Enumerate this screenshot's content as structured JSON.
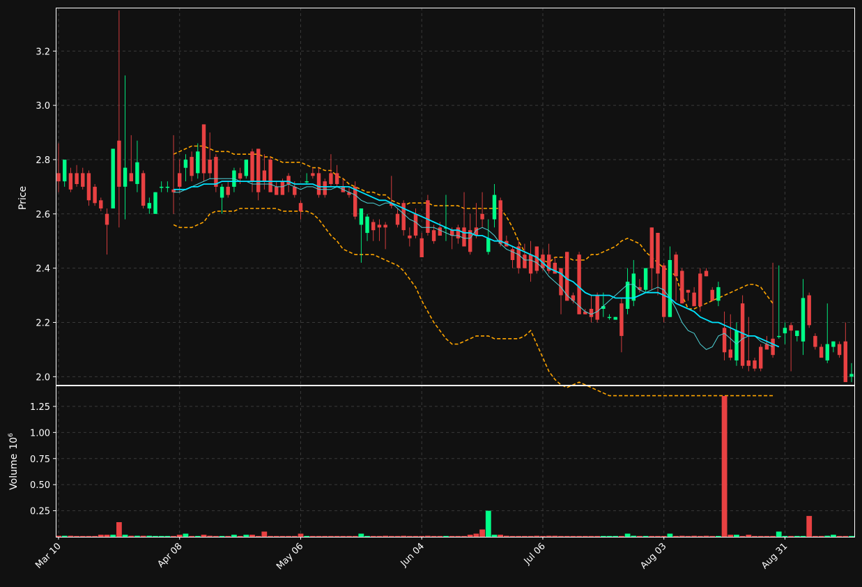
{
  "chart_data": {
    "type": "candlestick",
    "price_panel": {
      "ylabel": "Price",
      "ylim": [
        1.97,
        3.36
      ],
      "yticks": [
        "2.0",
        "2.2",
        "2.4",
        "2.6",
        "2.8",
        "3.0",
        "3.2"
      ],
      "grid": true
    },
    "volume_panel": {
      "ylabel": "Volume",
      "ylabel_exponent": "10",
      "ylabel_exponent_power": "6",
      "ylim": [
        0,
        1.45
      ],
      "yticks": [
        "0.25",
        "0.50",
        "0.75",
        "1.00",
        "1.25"
      ],
      "grid": true
    },
    "x_ticks": [
      {
        "label": "Mar 10",
        "index": 0
      },
      {
        "label": "Apr 08",
        "index": 20
      },
      {
        "label": "May 06",
        "index": 40
      },
      {
        "label": "Jun 04",
        "index": 60
      },
      {
        "label": "Jul 06",
        "index": 80
      },
      {
        "label": "Aug 03",
        "index": 100
      },
      {
        "label": "Aug 31",
        "index": 120
      }
    ],
    "colors": {
      "up": "#00ff88",
      "down": "#e84142",
      "ma_long": "#00e5ff",
      "ma_short": "#4fd4d9",
      "bands": "#ffa500"
    },
    "candles": [
      [
        2.75,
        2.86,
        2.68,
        2.72,
        0.01
      ],
      [
        2.72,
        2.8,
        2.7,
        2.8,
        0.01
      ],
      [
        2.75,
        2.77,
        2.68,
        2.69,
        0.01
      ],
      [
        2.75,
        2.78,
        2.7,
        2.71,
        0.0
      ],
      [
        2.75,
        2.77,
        2.69,
        2.7,
        0.0
      ],
      [
        2.75,
        2.76,
        2.63,
        2.65,
        0.0
      ],
      [
        2.7,
        2.71,
        2.63,
        2.64,
        0.0
      ],
      [
        2.65,
        2.66,
        2.61,
        2.62,
        0.02
      ],
      [
        2.6,
        2.62,
        2.45,
        2.56,
        0.02
      ],
      [
        2.62,
        2.84,
        2.62,
        2.84,
        0.02
      ],
      [
        2.87,
        3.35,
        2.55,
        2.7,
        0.14
      ],
      [
        2.7,
        3.11,
        2.58,
        2.77,
        0.02
      ],
      [
        2.75,
        2.89,
        2.72,
        2.72,
        0.01
      ],
      [
        2.71,
        2.87,
        2.68,
        2.79,
        0.01
      ],
      [
        2.75,
        2.76,
        2.62,
        2.63,
        0.01
      ],
      [
        2.62,
        2.66,
        2.6,
        2.64,
        0.01
      ],
      [
        2.6,
        2.68,
        2.6,
        2.68,
        0.0
      ],
      [
        2.7,
        2.72,
        2.68,
        2.7,
        0.0
      ],
      [
        2.7,
        2.72,
        2.68,
        2.7,
        0.0
      ],
      [
        2.69,
        2.89,
        2.6,
        2.68,
        0.0
      ],
      [
        2.75,
        2.8,
        2.68,
        2.7,
        0.02
      ],
      [
        2.77,
        2.82,
        2.72,
        2.8,
        0.03
      ],
      [
        2.81,
        2.83,
        2.72,
        2.74,
        0.0
      ],
      [
        2.75,
        2.86,
        2.73,
        2.83,
        0.0
      ],
      [
        2.93,
        2.93,
        2.72,
        2.75,
        0.02
      ],
      [
        2.8,
        2.9,
        2.73,
        2.75,
        0.01
      ],
      [
        2.81,
        2.82,
        2.68,
        2.7,
        0.0
      ],
      [
        2.66,
        2.71,
        2.6,
        2.7,
        0.0
      ],
      [
        2.7,
        2.72,
        2.66,
        2.67,
        0.0
      ],
      [
        2.7,
        2.77,
        2.68,
        2.76,
        0.02
      ],
      [
        2.75,
        2.77,
        2.71,
        2.73,
        0.0
      ],
      [
        2.74,
        2.8,
        2.73,
        2.8,
        0.02
      ],
      [
        2.83,
        2.84,
        2.68,
        2.72,
        0.02
      ],
      [
        2.84,
        2.84,
        2.65,
        2.68,
        0.0
      ],
      [
        2.76,
        2.82,
        2.69,
        2.72,
        0.05
      ],
      [
        2.8,
        2.81,
        2.68,
        2.68,
        0.0
      ],
      [
        2.7,
        2.72,
        2.67,
        2.67,
        0.0
      ],
      [
        2.72,
        2.73,
        2.67,
        2.67,
        0.0
      ],
      [
        2.74,
        2.75,
        2.68,
        2.71,
        0.0
      ],
      [
        2.7,
        2.72,
        2.66,
        2.67,
        0.0
      ],
      [
        2.64,
        2.65,
        2.58,
        2.61,
        0.03
      ],
      [
        2.72,
        2.75,
        2.71,
        2.72,
        0.0
      ],
      [
        2.75,
        2.77,
        2.73,
        2.74,
        0.0
      ],
      [
        2.75,
        2.77,
        2.66,
        2.67,
        0.0
      ],
      [
        2.72,
        2.73,
        2.66,
        2.67,
        0.0
      ],
      [
        2.75,
        2.82,
        2.7,
        2.71,
        0.0
      ],
      [
        2.75,
        2.78,
        2.7,
        2.71,
        0.0
      ],
      [
        2.7,
        2.73,
        2.68,
        2.68,
        0.0
      ],
      [
        2.68,
        2.7,
        2.66,
        2.67,
        0.0
      ],
      [
        2.7,
        2.72,
        2.58,
        2.59,
        0.0
      ],
      [
        2.56,
        2.62,
        2.42,
        2.62,
        0.03
      ],
      [
        2.53,
        2.6,
        2.5,
        2.59,
        0.0
      ],
      [
        2.57,
        2.58,
        2.5,
        2.54,
        0.0
      ],
      [
        2.56,
        2.58,
        2.5,
        2.55,
        0.0
      ],
      [
        2.56,
        2.57,
        2.47,
        2.55,
        0.01
      ],
      [
        2.64,
        2.74,
        2.62,
        2.63,
        0.0
      ],
      [
        2.6,
        2.62,
        2.55,
        2.56,
        0.0
      ],
      [
        2.64,
        2.65,
        2.52,
        2.54,
        0.01
      ],
      [
        2.52,
        2.55,
        2.48,
        2.51,
        0.0
      ],
      [
        2.6,
        2.62,
        2.51,
        2.52,
        0.0
      ],
      [
        2.51,
        2.53,
        2.45,
        2.44,
        0.0
      ],
      [
        2.65,
        2.67,
        2.52,
        2.53,
        0.01
      ],
      [
        2.54,
        2.56,
        2.49,
        2.5,
        0.0
      ],
      [
        2.55,
        2.57,
        2.52,
        2.52,
        0.0
      ],
      [
        2.55,
        2.67,
        2.5,
        2.55,
        0.0
      ],
      [
        2.54,
        2.55,
        2.47,
        2.52,
        0.0
      ],
      [
        2.55,
        2.56,
        2.49,
        2.51,
        0.0
      ],
      [
        2.55,
        2.68,
        2.5,
        2.48,
        0.0
      ],
      [
        2.54,
        2.6,
        2.45,
        2.46,
        0.02
      ],
      [
        2.55,
        2.64,
        2.51,
        2.52,
        0.03
      ],
      [
        2.6,
        2.68,
        2.55,
        2.58,
        0.07
      ],
      [
        2.46,
        2.58,
        2.45,
        2.51,
        0.25
      ],
      [
        2.58,
        2.71,
        2.55,
        2.67,
        0.02
      ],
      [
        2.65,
        2.66,
        2.48,
        2.49,
        0.02
      ],
      [
        2.5,
        2.52,
        2.48,
        2.48,
        0.01
      ],
      [
        2.47,
        2.48,
        2.4,
        2.43,
        0.0
      ],
      [
        2.48,
        2.5,
        2.38,
        2.4,
        0.0
      ],
      [
        2.45,
        2.49,
        2.4,
        2.4,
        0.0
      ],
      [
        2.45,
        2.5,
        2.35,
        2.38,
        0.0
      ],
      [
        2.48,
        2.48,
        2.38,
        2.39,
        0.01
      ],
      [
        2.45,
        2.47,
        2.39,
        2.4,
        0.0
      ],
      [
        2.45,
        2.49,
        2.38,
        2.39,
        0.01
      ],
      [
        2.42,
        2.44,
        2.38,
        2.38,
        0.01
      ],
      [
        2.4,
        2.4,
        2.23,
        2.3,
        0.0
      ],
      [
        2.46,
        2.46,
        2.28,
        2.28,
        0.0
      ],
      [
        2.3,
        2.31,
        2.27,
        2.28,
        0.0
      ],
      [
        2.45,
        2.46,
        2.23,
        2.23,
        0.0
      ],
      [
        2.24,
        2.25,
        2.23,
        2.23,
        0.0
      ],
      [
        2.25,
        2.3,
        2.2,
        2.22,
        0.0
      ],
      [
        2.3,
        2.31,
        2.2,
        2.21,
        0.0
      ],
      [
        2.25,
        2.31,
        2.22,
        2.26,
        0.0
      ],
      [
        2.22,
        2.23,
        2.21,
        2.22,
        0.0
      ],
      [
        2.21,
        2.22,
        2.21,
        2.22,
        0.0
      ],
      [
        2.27,
        2.29,
        2.09,
        2.15,
        0.0
      ],
      [
        2.25,
        2.4,
        2.23,
        2.35,
        0.03
      ],
      [
        2.28,
        2.43,
        2.26,
        2.38,
        0.01
      ],
      [
        2.33,
        2.36,
        2.31,
        2.32,
        0.0
      ],
      [
        2.32,
        2.4,
        2.31,
        2.4,
        0.0
      ],
      [
        2.55,
        2.55,
        2.32,
        2.4,
        0.0
      ],
      [
        2.53,
        2.53,
        2.3,
        2.38,
        0.0
      ],
      [
        2.41,
        2.42,
        2.2,
        2.22,
        0.0
      ],
      [
        2.22,
        2.48,
        2.22,
        2.43,
        0.03
      ],
      [
        2.45,
        2.46,
        2.28,
        2.37,
        0.0
      ],
      [
        2.39,
        2.4,
        2.27,
        2.27,
        0.01
      ],
      [
        2.32,
        2.32,
        2.28,
        2.31,
        0.0
      ],
      [
        2.31,
        2.33,
        2.26,
        2.26,
        0.01
      ],
      [
        2.38,
        2.4,
        2.24,
        2.26,
        0.0
      ],
      [
        2.39,
        2.4,
        2.37,
        2.37,
        0.01
      ],
      [
        2.32,
        2.33,
        2.28,
        2.28,
        0.0
      ],
      [
        2.28,
        2.35,
        2.26,
        2.33,
        0.0
      ],
      [
        2.18,
        2.24,
        2.06,
        2.09,
        1.35
      ],
      [
        2.1,
        2.23,
        2.06,
        2.07,
        0.02
      ],
      [
        2.06,
        2.2,
        2.04,
        2.17,
        0.02
      ],
      [
        2.27,
        2.3,
        2.03,
        2.04,
        0.0
      ],
      [
        2.06,
        2.22,
        2.02,
        2.04,
        0.02
      ],
      [
        2.06,
        2.07,
        2.02,
        2.03,
        0.0
      ],
      [
        2.11,
        2.12,
        2.02,
        2.03,
        0.0
      ],
      [
        2.12,
        2.15,
        2.11,
        2.1,
        0.0
      ],
      [
        2.14,
        2.42,
        2.07,
        2.08,
        0.0
      ],
      [
        2.15,
        2.41,
        2.14,
        2.15,
        0.05
      ],
      [
        2.16,
        2.2,
        2.12,
        2.18,
        0.0
      ],
      [
        2.19,
        2.2,
        2.02,
        2.17,
        0.0
      ],
      [
        2.15,
        2.16,
        2.13,
        2.17,
        0.0
      ],
      [
        2.13,
        2.36,
        2.08,
        2.29,
        0.0
      ],
      [
        2.3,
        2.31,
        2.18,
        2.19,
        0.2
      ],
      [
        2.15,
        2.16,
        2.1,
        2.11,
        0.0
      ],
      [
        2.11,
        2.12,
        2.08,
        2.07,
        0.0
      ],
      [
        2.06,
        2.27,
        2.05,
        2.12,
        0.01
      ],
      [
        2.11,
        2.13,
        2.09,
        2.13,
        0.02
      ],
      [
        2.12,
        2.13,
        2.07,
        2.08,
        0.0
      ],
      [
        2.13,
        2.2,
        2.02,
        1.98,
        0.0
      ],
      [
        2.0,
        2.05,
        1.98,
        2.01,
        0.0
      ]
    ],
    "ma_long": [
      null,
      null,
      null,
      null,
      null,
      null,
      null,
      null,
      null,
      null,
      null,
      null,
      null,
      null,
      null,
      null,
      null,
      null,
      null,
      2.69,
      2.69,
      2.69,
      2.7,
      2.7,
      2.71,
      2.71,
      2.71,
      2.72,
      2.72,
      2.72,
      2.72,
      2.72,
      2.72,
      2.72,
      2.72,
      2.72,
      2.72,
      2.72,
      2.72,
      2.71,
      2.71,
      2.71,
      2.71,
      2.7,
      2.7,
      2.7,
      2.7,
      2.7,
      2.7,
      2.69,
      2.68,
      2.67,
      2.66,
      2.65,
      2.65,
      2.64,
      2.63,
      2.62,
      2.61,
      2.6,
      2.59,
      2.58,
      2.57,
      2.56,
      2.55,
      2.54,
      2.54,
      2.53,
      2.53,
      2.52,
      2.52,
      2.51,
      2.5,
      2.5,
      2.49,
      2.48,
      2.47,
      2.46,
      2.45,
      2.44,
      2.42,
      2.4,
      2.39,
      2.38,
      2.36,
      2.35,
      2.33,
      2.31,
      2.3,
      2.3,
      2.3,
      2.3,
      2.29,
      2.29,
      2.29,
      2.29,
      2.3,
      2.31,
      2.31,
      2.31,
      2.3,
      2.29,
      2.27,
      2.26,
      2.25,
      2.24,
      2.22,
      2.21,
      2.2,
      2.2,
      2.19,
      2.18,
      2.17,
      2.16,
      2.15,
      2.15,
      2.14,
      2.13,
      2.12,
      2.11
    ],
    "ma_short": [
      null,
      null,
      null,
      null,
      null,
      null,
      null,
      null,
      null,
      null,
      null,
      null,
      null,
      null,
      null,
      null,
      null,
      null,
      null,
      2.68,
      2.68,
      2.69,
      2.7,
      2.71,
      2.72,
      2.73,
      2.73,
      2.73,
      2.73,
      2.73,
      2.72,
      2.72,
      2.71,
      2.71,
      2.71,
      2.71,
      2.7,
      2.7,
      2.71,
      2.7,
      2.69,
      2.7,
      2.7,
      2.69,
      2.69,
      2.69,
      2.7,
      2.69,
      2.68,
      2.67,
      2.65,
      2.64,
      2.64,
      2.63,
      2.64,
      2.64,
      2.62,
      2.6,
      2.58,
      2.57,
      2.55,
      2.55,
      2.55,
      2.54,
      2.53,
      2.52,
      2.52,
      2.51,
      2.51,
      2.54,
      2.55,
      2.54,
      2.52,
      2.49,
      2.47,
      2.46,
      2.45,
      2.43,
      2.43,
      2.42,
      2.4,
      2.37,
      2.35,
      2.33,
      2.3,
      2.28,
      2.26,
      2.24,
      2.23,
      2.24,
      2.26,
      2.28,
      2.3,
      2.32,
      2.34,
      2.34,
      2.32,
      2.31,
      2.32,
      2.33,
      2.32,
      2.29,
      2.25,
      2.2,
      2.17,
      2.16,
      2.12,
      2.1,
      2.11,
      2.15,
      2.16,
      2.14,
      2.12,
      2.14,
      2.15,
      2.15,
      2.13,
      2.12,
      2.11
    ],
    "band_upper": [
      null,
      null,
      null,
      null,
      null,
      null,
      null,
      null,
      null,
      null,
      null,
      null,
      null,
      null,
      null,
      null,
      null,
      null,
      null,
      2.82,
      2.83,
      2.84,
      2.85,
      2.85,
      2.85,
      2.84,
      2.83,
      2.83,
      2.83,
      2.82,
      2.82,
      2.82,
      2.82,
      2.82,
      2.81,
      2.81,
      2.8,
      2.79,
      2.79,
      2.79,
      2.79,
      2.78,
      2.77,
      2.77,
      2.76,
      2.76,
      2.74,
      2.73,
      2.71,
      2.7,
      2.69,
      2.68,
      2.68,
      2.67,
      2.67,
      2.65,
      2.64,
      2.63,
      2.64,
      2.64,
      2.64,
      2.64,
      2.63,
      2.63,
      2.63,
      2.63,
      2.63,
      2.62,
      2.62,
      2.62,
      2.62,
      2.62,
      2.62,
      2.62,
      2.59,
      2.55,
      2.5,
      2.46,
      2.45,
      2.44,
      2.43,
      2.42,
      2.44,
      2.44,
      2.44,
      2.43,
      2.43,
      2.43,
      2.45,
      2.45,
      2.46,
      2.47,
      2.48,
      2.5,
      2.51,
      2.5,
      2.49,
      2.46,
      2.44,
      2.42,
      2.4,
      2.39,
      2.37,
      2.3,
      2.25,
      2.25,
      2.26,
      2.27,
      2.28,
      2.29,
      2.3,
      2.31,
      2.32,
      2.33,
      2.34,
      2.34,
      2.33,
      2.3,
      2.27
    ],
    "band_lower": [
      null,
      null,
      null,
      null,
      null,
      null,
      null,
      null,
      null,
      null,
      null,
      null,
      null,
      null,
      null,
      null,
      null,
      null,
      null,
      2.56,
      2.55,
      2.55,
      2.55,
      2.56,
      2.57,
      2.6,
      2.61,
      2.61,
      2.61,
      2.61,
      2.62,
      2.62,
      2.62,
      2.62,
      2.62,
      2.62,
      2.62,
      2.61,
      2.61,
      2.61,
      2.61,
      2.61,
      2.6,
      2.58,
      2.55,
      2.52,
      2.5,
      2.47,
      2.46,
      2.45,
      2.45,
      2.45,
      2.45,
      2.44,
      2.43,
      2.42,
      2.41,
      2.39,
      2.36,
      2.33,
      2.28,
      2.24,
      2.2,
      2.17,
      2.14,
      2.12,
      2.12,
      2.13,
      2.14,
      2.15,
      2.15,
      2.15,
      2.14,
      2.14,
      2.14,
      2.14,
      2.14,
      2.15,
      2.17,
      2.12,
      2.07,
      2.02,
      1.99,
      1.97,
      1.96,
      1.97,
      1.98,
      1.97,
      1.96,
      1.95,
      1.94,
      1.93,
      1.93,
      1.93,
      1.93,
      1.93,
      1.93,
      1.93,
      1.93,
      1.93,
      1.93,
      1.93,
      1.93,
      1.93,
      1.93,
      1.93,
      1.93,
      1.93,
      1.93,
      1.93,
      1.93,
      1.93,
      1.93,
      1.93,
      1.93,
      1.93,
      1.93,
      1.93,
      1.93
    ]
  }
}
